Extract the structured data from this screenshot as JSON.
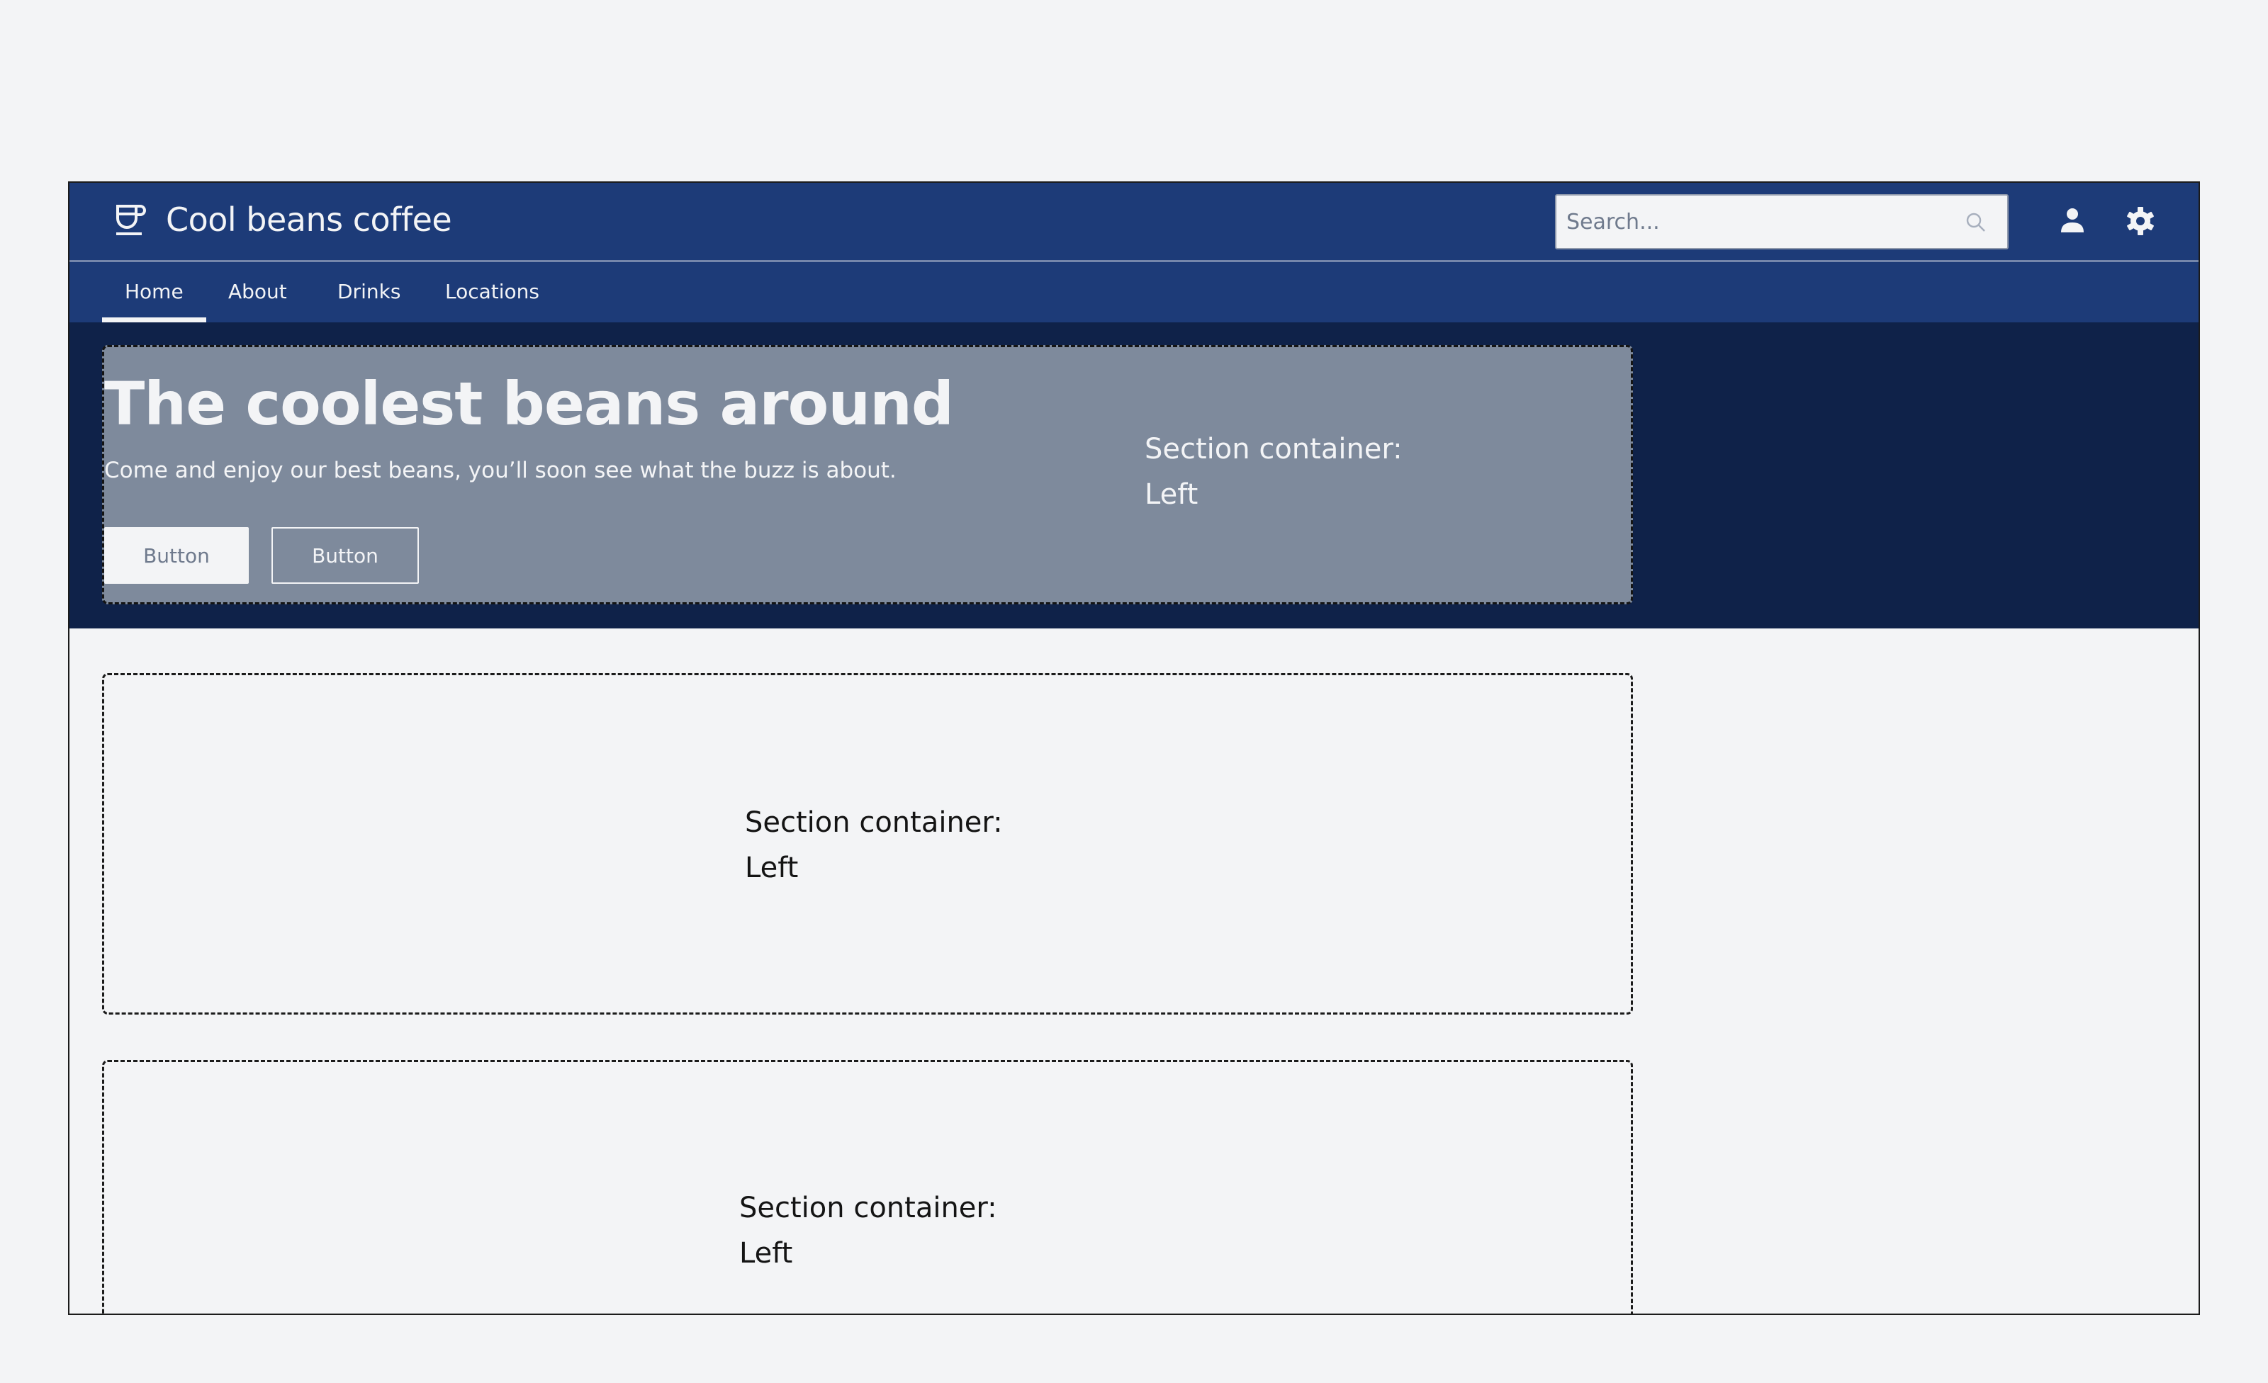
{
  "header": {
    "logo_icon": "coffee-cup-icon",
    "brand": "Cool beans coffee",
    "search": {
      "placeholder": "Search...",
      "value": "",
      "icon": "search-icon"
    },
    "actions": [
      {
        "name": "user",
        "icon": "user-icon"
      },
      {
        "name": "settings",
        "icon": "gear-icon"
      }
    ]
  },
  "nav": {
    "items": [
      {
        "label": "Home",
        "active": true
      },
      {
        "label": "About",
        "active": false
      },
      {
        "label": "Drinks",
        "active": false
      },
      {
        "label": "Locations",
        "active": false
      }
    ]
  },
  "hero": {
    "title": "The coolest beans around",
    "subtitle": "Come and enjoy our best beans, you’ll soon see what the buzz is about.",
    "primary_button": "Button",
    "secondary_button": "Button",
    "section_label_line1": "Section container:",
    "section_label_line2": "Left"
  },
  "sections": [
    {
      "label_line1": "Section container:",
      "label_line2": "Left"
    },
    {
      "label_line1": "Section container:",
      "label_line2": "Left"
    }
  ],
  "colors": {
    "header_bg": "#1d3b78",
    "hero_bg": "#0f2249",
    "hero_box_bg": "#7e8a9c",
    "page_bg": "#f3f4f6",
    "text_light": "#f3f4f6",
    "text_dark": "#141414"
  }
}
